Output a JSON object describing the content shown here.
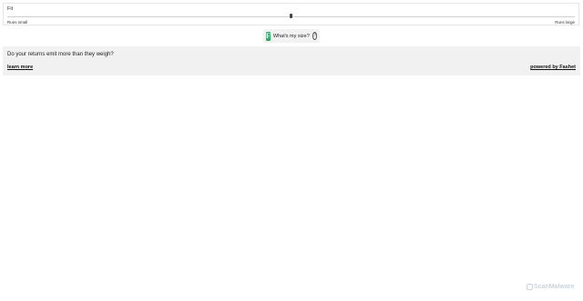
{
  "fit": {
    "title": "Fit",
    "low_label": "Runs small",
    "high_label": "Runs large",
    "position": 0.5
  },
  "size_button": {
    "label": "What's my size?",
    "logo_letter": "F",
    "help_glyph": "?",
    "logo_color": "#3aa46a"
  },
  "banner": {
    "question": "Do your returns emit more than they weigh?",
    "learn_more": "learn more",
    "powered_by": "powered by Fashet"
  },
  "watermark": {
    "text": "ScanMalware"
  }
}
